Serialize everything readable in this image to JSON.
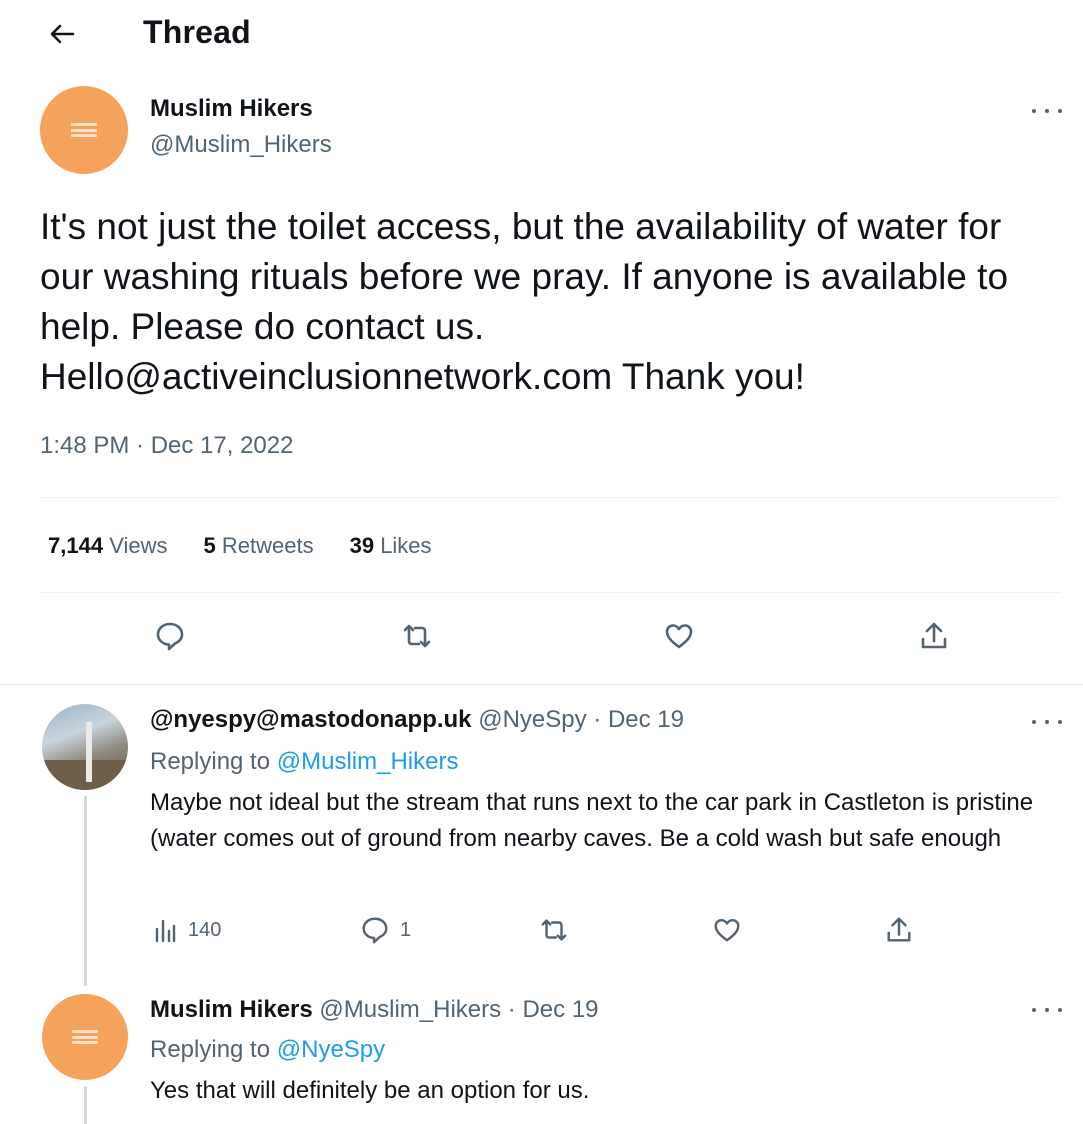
{
  "header": {
    "title": "Thread"
  },
  "main_tweet": {
    "name": "Muslim Hikers",
    "handle": "@Muslim_Hikers",
    "text": "It's not just the toilet access, but the availability of water for our washing rituals before we pray. If anyone is available to help. Please do contact us. Hello@activeinclusionnetwork.com Thank you!",
    "timestamp": "1:48 PM · Dec 17, 2022",
    "views_count": "7,144",
    "views_label": "Views",
    "retweets_count": "5",
    "retweets_label": "Retweets",
    "likes_count": "39",
    "likes_label": "Likes"
  },
  "replies": [
    {
      "name": "@nyespy@mastodonapp.uk",
      "handle": "@NyeSpy",
      "date": "Dec 19",
      "replying_to_label": "Replying to",
      "replying_to_handle": "@Muslim_Hikers",
      "text": "Maybe not ideal but the stream that runs next to the car park in Castleton is pristine (water comes out of ground from nearby caves. Be a cold wash but safe enough",
      "views": "140",
      "replies": "1"
    },
    {
      "name": "Muslim Hikers",
      "handle": "@Muslim_Hikers",
      "date": "Dec 19",
      "replying_to_label": "Replying to",
      "replying_to_handle": "@NyeSpy",
      "text": "Yes that will definitely be an option for us."
    }
  ],
  "icons": {
    "back": "arrow-left-icon",
    "more": "more-horizontal-icon",
    "reply": "comment-icon",
    "retweet": "retweet-icon",
    "like": "heart-icon",
    "share": "share-icon",
    "views": "bar-chart-icon"
  },
  "colors": {
    "accent": "#1d9bf0",
    "secondary_text": "#536471",
    "avatar": "#f4a25c"
  }
}
